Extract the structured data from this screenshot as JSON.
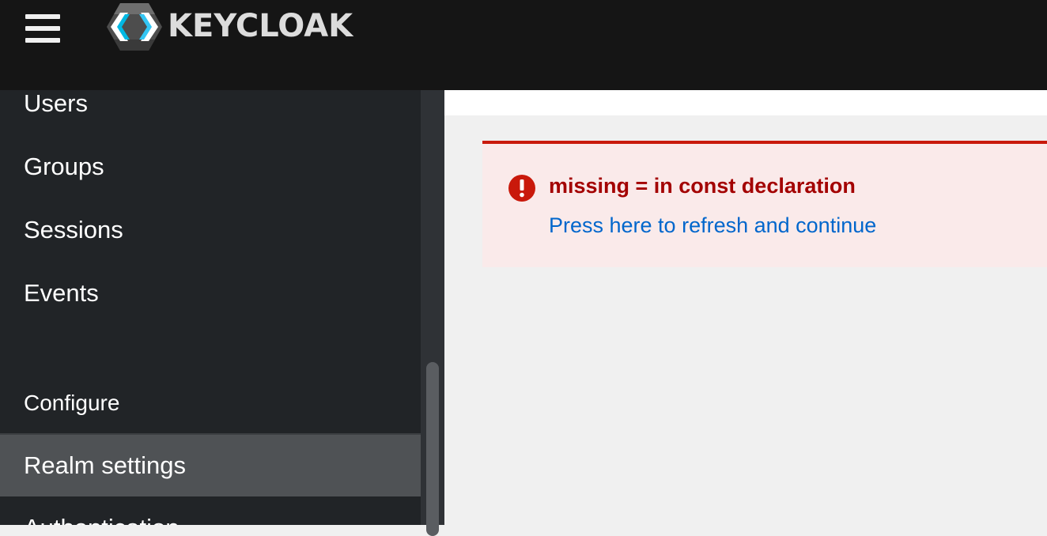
{
  "header": {
    "brand": "KEYCLOAK"
  },
  "sidebar": {
    "items": [
      {
        "label": "Users"
      },
      {
        "label": "Groups"
      },
      {
        "label": "Sessions"
      },
      {
        "label": "Events"
      }
    ],
    "section": "Configure",
    "configure_items": [
      {
        "label": "Realm settings",
        "active": true
      },
      {
        "label": "Authentication"
      }
    ]
  },
  "alert": {
    "title": "missing = in const declaration",
    "link": "Press here to refresh and continue",
    "icon": "exclamation-circle-icon",
    "color": "#c9190b"
  },
  "colors": {
    "masthead": "#151515",
    "sidebar": "#212427",
    "active_item": "#4f5255",
    "link": "#0066cc",
    "danger": "#c9190b"
  }
}
